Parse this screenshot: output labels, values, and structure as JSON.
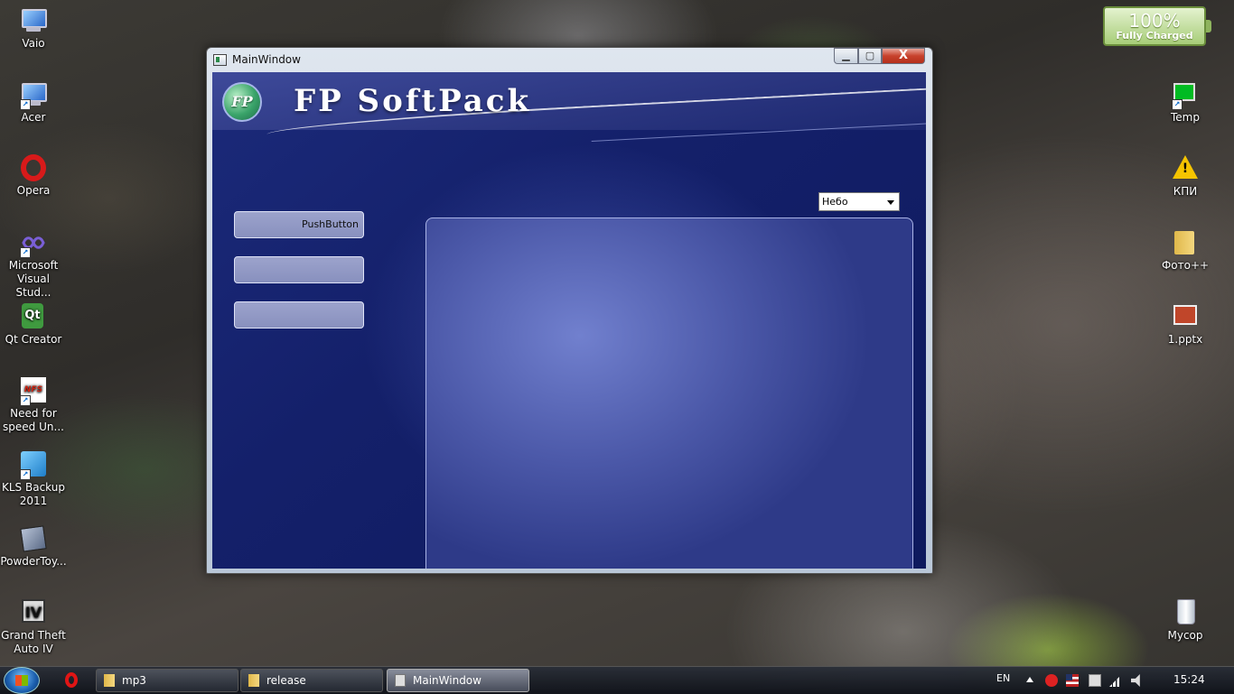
{
  "desktop": {
    "icons_left": [
      {
        "label": "Vaio",
        "icon": "computer-icon"
      },
      {
        "label": "Acer",
        "icon": "computer-icon"
      },
      {
        "label": "Opera",
        "icon": "opera-icon"
      },
      {
        "label": "Microsoft Visual Stud...",
        "icon": "visual-studio-icon"
      },
      {
        "label": "Qt Creator",
        "icon": "qt-icon"
      },
      {
        "label": "Need for speed Un...",
        "icon": "nfs-icon"
      },
      {
        "label": "KLS Backup 2011",
        "icon": "backup-icon"
      },
      {
        "label": "PowderToy...",
        "icon": "powdertoy-icon"
      },
      {
        "label": "Grand Theft Auto IV",
        "icon": "gta-icon"
      }
    ],
    "icons_right": [
      {
        "label": "Temp",
        "icon": "monitor-icon"
      },
      {
        "label": "КПИ",
        "icon": "warning-icon"
      },
      {
        "label": "Фото++",
        "icon": "folder-icon"
      },
      {
        "label": "1.pptx",
        "icon": "pptx-icon"
      },
      {
        "label": "Мусор",
        "icon": "recycle-bin-icon"
      }
    ],
    "icon_glyphs": {
      "qt": "Qt",
      "nfs": "NFS",
      "gta": "IV",
      "warning": "!"
    }
  },
  "battery_gadget": {
    "percent": "100%",
    "status": "Fully Charged",
    "level": 1.0,
    "color": "#a7cd78"
  },
  "window": {
    "title": "MainWindow",
    "controls": {
      "close_glyph": "X"
    },
    "brand": {
      "logo_text": "FP",
      "name": "FP SoftPack"
    },
    "combo": {
      "selected": "Небо"
    },
    "side_buttons": [
      {
        "label": "PushButton"
      },
      {
        "label": ""
      },
      {
        "label": ""
      }
    ],
    "bottom_buttons": [
      {
        "label": ""
      },
      {
        "label": ""
      }
    ],
    "colors": {
      "background": "#14206a",
      "panel": "#6a78c8"
    }
  },
  "taskbar": {
    "items": [
      {
        "label": "mp3",
        "icon": "folder-icon"
      },
      {
        "label": "release",
        "icon": "folder-icon"
      },
      {
        "label": "MainWindow",
        "icon": "window-icon",
        "active": true
      }
    ],
    "tray": {
      "language": "EN",
      "time": "15:24"
    }
  }
}
